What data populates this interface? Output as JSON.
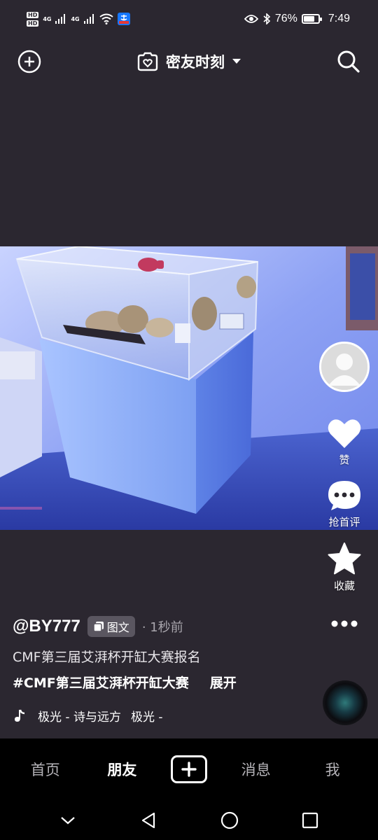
{
  "status_bar": {
    "hd1": "HD",
    "hd2": "HD",
    "net1": "4G",
    "net2": "4G",
    "battery_percent_text": "76%",
    "battery_level": 0.76,
    "time": "7:49"
  },
  "top_bar": {
    "title": "密友时刻"
  },
  "rail": {
    "like_label": "赞",
    "comment_label": "抢首评",
    "favorite_label": "收藏"
  },
  "post": {
    "author": "@BY777",
    "type_badge": "图文",
    "time": "· 1秒前",
    "description": "CMF第三届艾湃杯开缸大赛报名",
    "hashtag": "#CMF第三届艾湃杯开缸大赛",
    "expand_label": "展开",
    "music_title": "极光 - 诗与远方",
    "music_title_2": "极光 -"
  },
  "bottom_nav": {
    "home": "首页",
    "friends": "朋友",
    "messages": "消息",
    "me": "我"
  },
  "colors": {
    "background": "#2b2730",
    "nav_background": "#000000",
    "accent_white": "#ffffff"
  }
}
